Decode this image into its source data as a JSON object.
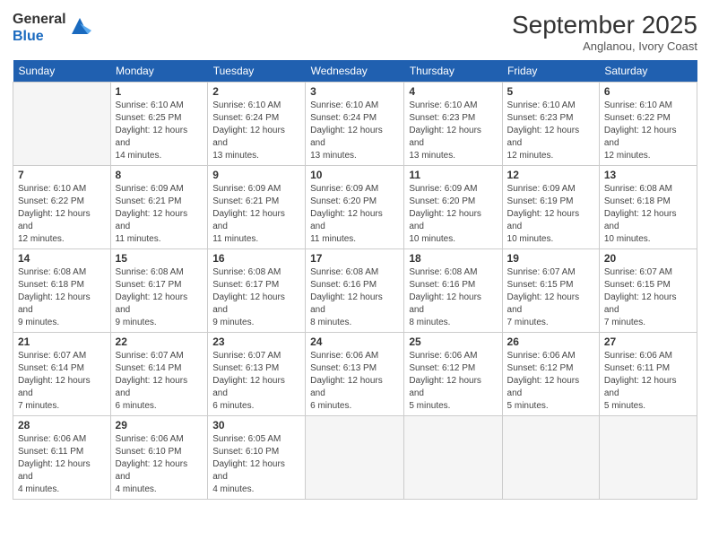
{
  "logo": {
    "general": "General",
    "blue": "Blue"
  },
  "header": {
    "month": "September 2025",
    "location": "Anglanou, Ivory Coast"
  },
  "weekdays": [
    "Sunday",
    "Monday",
    "Tuesday",
    "Wednesday",
    "Thursday",
    "Friday",
    "Saturday"
  ],
  "weeks": [
    [
      {
        "day": "",
        "sunrise": "",
        "sunset": "",
        "daylight": ""
      },
      {
        "day": "1",
        "sunrise": "Sunrise: 6:10 AM",
        "sunset": "Sunset: 6:25 PM",
        "daylight": "Daylight: 12 hours and 14 minutes."
      },
      {
        "day": "2",
        "sunrise": "Sunrise: 6:10 AM",
        "sunset": "Sunset: 6:24 PM",
        "daylight": "Daylight: 12 hours and 13 minutes."
      },
      {
        "day": "3",
        "sunrise": "Sunrise: 6:10 AM",
        "sunset": "Sunset: 6:24 PM",
        "daylight": "Daylight: 12 hours and 13 minutes."
      },
      {
        "day": "4",
        "sunrise": "Sunrise: 6:10 AM",
        "sunset": "Sunset: 6:23 PM",
        "daylight": "Daylight: 12 hours and 13 minutes."
      },
      {
        "day": "5",
        "sunrise": "Sunrise: 6:10 AM",
        "sunset": "Sunset: 6:23 PM",
        "daylight": "Daylight: 12 hours and 12 minutes."
      },
      {
        "day": "6",
        "sunrise": "Sunrise: 6:10 AM",
        "sunset": "Sunset: 6:22 PM",
        "daylight": "Daylight: 12 hours and 12 minutes."
      }
    ],
    [
      {
        "day": "7",
        "sunrise": "Sunrise: 6:10 AM",
        "sunset": "Sunset: 6:22 PM",
        "daylight": "Daylight: 12 hours and 12 minutes."
      },
      {
        "day": "8",
        "sunrise": "Sunrise: 6:09 AM",
        "sunset": "Sunset: 6:21 PM",
        "daylight": "Daylight: 12 hours and 11 minutes."
      },
      {
        "day": "9",
        "sunrise": "Sunrise: 6:09 AM",
        "sunset": "Sunset: 6:21 PM",
        "daylight": "Daylight: 12 hours and 11 minutes."
      },
      {
        "day": "10",
        "sunrise": "Sunrise: 6:09 AM",
        "sunset": "Sunset: 6:20 PM",
        "daylight": "Daylight: 12 hours and 11 minutes."
      },
      {
        "day": "11",
        "sunrise": "Sunrise: 6:09 AM",
        "sunset": "Sunset: 6:20 PM",
        "daylight": "Daylight: 12 hours and 10 minutes."
      },
      {
        "day": "12",
        "sunrise": "Sunrise: 6:09 AM",
        "sunset": "Sunset: 6:19 PM",
        "daylight": "Daylight: 12 hours and 10 minutes."
      },
      {
        "day": "13",
        "sunrise": "Sunrise: 6:08 AM",
        "sunset": "Sunset: 6:18 PM",
        "daylight": "Daylight: 12 hours and 10 minutes."
      }
    ],
    [
      {
        "day": "14",
        "sunrise": "Sunrise: 6:08 AM",
        "sunset": "Sunset: 6:18 PM",
        "daylight": "Daylight: 12 hours and 9 minutes."
      },
      {
        "day": "15",
        "sunrise": "Sunrise: 6:08 AM",
        "sunset": "Sunset: 6:17 PM",
        "daylight": "Daylight: 12 hours and 9 minutes."
      },
      {
        "day": "16",
        "sunrise": "Sunrise: 6:08 AM",
        "sunset": "Sunset: 6:17 PM",
        "daylight": "Daylight: 12 hours and 9 minutes."
      },
      {
        "day": "17",
        "sunrise": "Sunrise: 6:08 AM",
        "sunset": "Sunset: 6:16 PM",
        "daylight": "Daylight: 12 hours and 8 minutes."
      },
      {
        "day": "18",
        "sunrise": "Sunrise: 6:08 AM",
        "sunset": "Sunset: 6:16 PM",
        "daylight": "Daylight: 12 hours and 8 minutes."
      },
      {
        "day": "19",
        "sunrise": "Sunrise: 6:07 AM",
        "sunset": "Sunset: 6:15 PM",
        "daylight": "Daylight: 12 hours and 7 minutes."
      },
      {
        "day": "20",
        "sunrise": "Sunrise: 6:07 AM",
        "sunset": "Sunset: 6:15 PM",
        "daylight": "Daylight: 12 hours and 7 minutes."
      }
    ],
    [
      {
        "day": "21",
        "sunrise": "Sunrise: 6:07 AM",
        "sunset": "Sunset: 6:14 PM",
        "daylight": "Daylight: 12 hours and 7 minutes."
      },
      {
        "day": "22",
        "sunrise": "Sunrise: 6:07 AM",
        "sunset": "Sunset: 6:14 PM",
        "daylight": "Daylight: 12 hours and 6 minutes."
      },
      {
        "day": "23",
        "sunrise": "Sunrise: 6:07 AM",
        "sunset": "Sunset: 6:13 PM",
        "daylight": "Daylight: 12 hours and 6 minutes."
      },
      {
        "day": "24",
        "sunrise": "Sunrise: 6:06 AM",
        "sunset": "Sunset: 6:13 PM",
        "daylight": "Daylight: 12 hours and 6 minutes."
      },
      {
        "day": "25",
        "sunrise": "Sunrise: 6:06 AM",
        "sunset": "Sunset: 6:12 PM",
        "daylight": "Daylight: 12 hours and 5 minutes."
      },
      {
        "day": "26",
        "sunrise": "Sunrise: 6:06 AM",
        "sunset": "Sunset: 6:12 PM",
        "daylight": "Daylight: 12 hours and 5 minutes."
      },
      {
        "day": "27",
        "sunrise": "Sunrise: 6:06 AM",
        "sunset": "Sunset: 6:11 PM",
        "daylight": "Daylight: 12 hours and 5 minutes."
      }
    ],
    [
      {
        "day": "28",
        "sunrise": "Sunrise: 6:06 AM",
        "sunset": "Sunset: 6:11 PM",
        "daylight": "Daylight: 12 hours and 4 minutes."
      },
      {
        "day": "29",
        "sunrise": "Sunrise: 6:06 AM",
        "sunset": "Sunset: 6:10 PM",
        "daylight": "Daylight: 12 hours and 4 minutes."
      },
      {
        "day": "30",
        "sunrise": "Sunrise: 6:05 AM",
        "sunset": "Sunset: 6:10 PM",
        "daylight": "Daylight: 12 hours and 4 minutes."
      },
      {
        "day": "",
        "sunrise": "",
        "sunset": "",
        "daylight": ""
      },
      {
        "day": "",
        "sunrise": "",
        "sunset": "",
        "daylight": ""
      },
      {
        "day": "",
        "sunrise": "",
        "sunset": "",
        "daylight": ""
      },
      {
        "day": "",
        "sunrise": "",
        "sunset": "",
        "daylight": ""
      }
    ]
  ]
}
